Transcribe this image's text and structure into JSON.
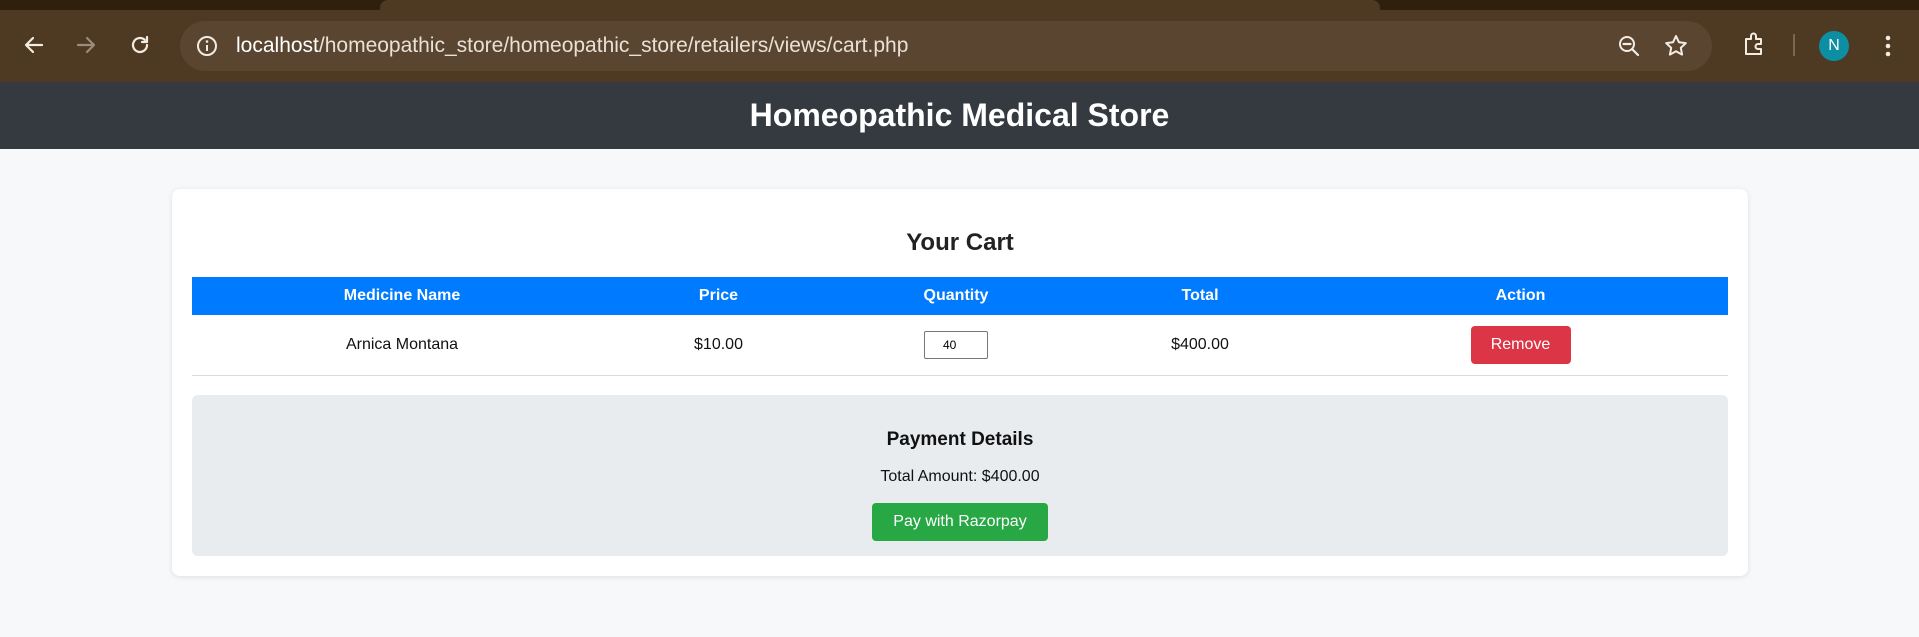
{
  "browser": {
    "url_host": "localhost",
    "url_path": "/homeopathic_store/homeopathic_store/retailers/views/cart.php",
    "profile_initial": "N",
    "icons": [
      "back-icon",
      "forward-icon",
      "reload-icon",
      "info-icon",
      "zoom-out-icon",
      "bookmark-star-icon",
      "extensions-icon",
      "menu-icon"
    ]
  },
  "site": {
    "title": "Homeopathic Medical Store"
  },
  "cart": {
    "heading": "Your Cart",
    "columns": [
      "Medicine Name",
      "Price",
      "Quantity",
      "Total",
      "Action"
    ],
    "rows": [
      {
        "name": "Arnica Montana",
        "price": "$10.00",
        "quantity": "40",
        "total": "$400.00",
        "action": "Remove"
      }
    ]
  },
  "payment": {
    "heading": "Payment Details",
    "total_text": "Total Amount: $400.00",
    "pay_label": "Pay with Razorpay"
  },
  "colors": {
    "header_bg": "#343a40",
    "table_header": "#007bff",
    "remove": "#dc3545",
    "pay": "#28a745"
  }
}
